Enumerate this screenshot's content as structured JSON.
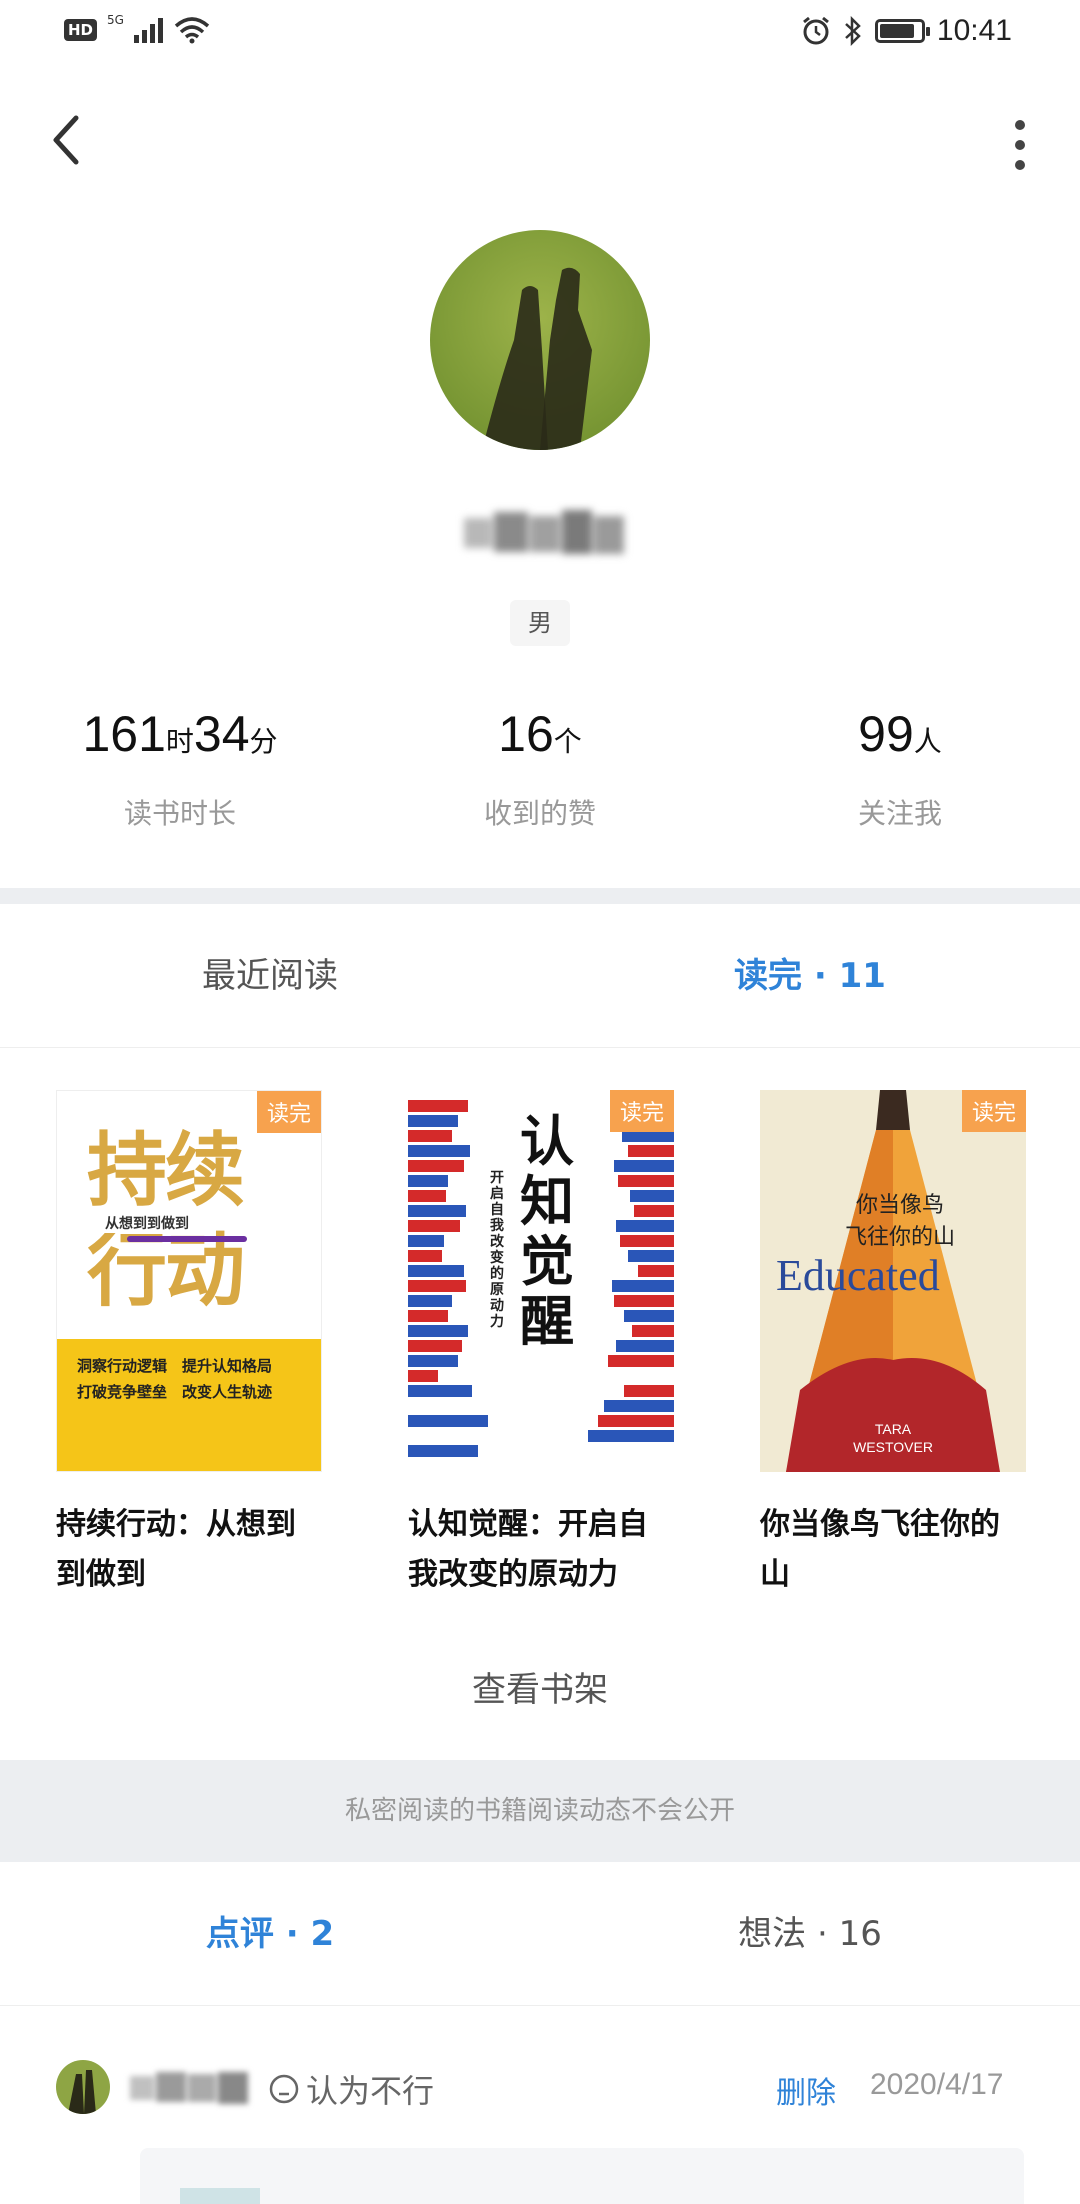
{
  "status_bar": {
    "hd_badge": "HD",
    "signal_label": "5G",
    "time": "10:41",
    "battery_level": 0.85
  },
  "nav": {
    "back_icon": "chevron-left-icon",
    "more_icon": "more-vertical-icon"
  },
  "profile": {
    "gender": "男"
  },
  "stats": [
    {
      "value_a": "161",
      "unit_a": "时",
      "value_b": "34",
      "unit_b": "分",
      "label": "读书时长"
    },
    {
      "value_a": "16",
      "unit_a": "个",
      "label": "收到的赞"
    },
    {
      "value_a": "99",
      "unit_a": "人",
      "label": "关注我"
    }
  ],
  "tabs": {
    "recent": "最近阅读",
    "finished": "读完 · 11"
  },
  "books": [
    {
      "title": "持续行动：从想到到做到",
      "badge": "读完",
      "cover_title": "持续行动",
      "cover_subtitle": "从想到到做到",
      "cover_lines": [
        "洞察行动逻辑　提升认知格局",
        "打破竞争壁垒　改变人生轨迹"
      ]
    },
    {
      "title": "认知觉醒：开启自我改变的原动力",
      "badge": "读完",
      "cover_title": "认知觉醒",
      "cover_subtitle": "开启自我改变的原动力"
    },
    {
      "title": "你当像鸟飞往你的山",
      "badge": "读完",
      "cover_title_cn": "你当像鸟\n飞往你的山",
      "cover_title_en": "Educated",
      "cover_author": "TARA\nWESTOVER"
    }
  ],
  "shelf_button": "查看书架",
  "private_notice": "私密阅读的书籍阅读动态不会公开",
  "tabs2": {
    "reviews": "点评 · 2",
    "ideas": "想法 · 16"
  },
  "review": {
    "rating_text": "认为不行",
    "delete_label": "删除",
    "date": "2020/4/17"
  },
  "colors": {
    "accent": "#2f83d8",
    "badge": "#f7a24e",
    "band": "#eceef1"
  }
}
